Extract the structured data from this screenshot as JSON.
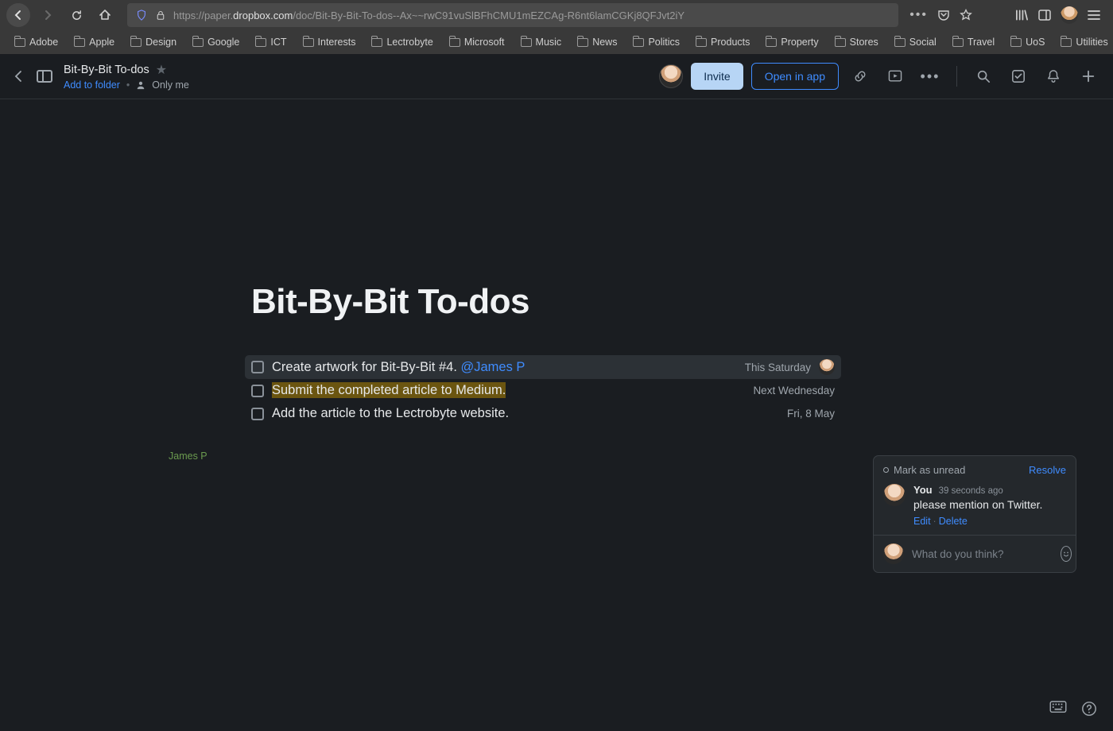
{
  "browser": {
    "url_prefix": "https://paper.",
    "url_host": "dropbox.com",
    "url_path": "/doc/Bit-By-Bit-To-dos--Ax~~rwC91vuSlBFhCMU1mEZCAg-R6nt6lamCGKj8QFJvt2iY",
    "bookmarks": [
      "Adobe",
      "Apple",
      "Design",
      "Google",
      "ICT",
      "Interests",
      "Lectrobyte",
      "Microsoft",
      "Music",
      "News",
      "Politics",
      "Products",
      "Property",
      "Stores",
      "Social",
      "Travel",
      "UoS",
      "Utilities"
    ]
  },
  "header": {
    "doc_title": "Bit-By-Bit To-dos",
    "add_to_folder": "Add to folder",
    "visibility": "Only me",
    "invite": "Invite",
    "open_in_app": "Open in app"
  },
  "document": {
    "title": "Bit-By-Bit To-dos",
    "author_label": "James P",
    "todos": [
      {
        "text": "Create artwork for Bit-By-Bit #4. ",
        "mention": "@James P",
        "due": "This Saturday",
        "has_avatar": true,
        "selected": true
      },
      {
        "text": "Submit the completed article to Medium.",
        "due": "Next Wednesday",
        "highlighted": true
      },
      {
        "text": "Add the article to the Lectrobyte website.",
        "due": "Fri, 8 May"
      }
    ]
  },
  "comment": {
    "mark_unread": "Mark as unread",
    "resolve": "Resolve",
    "author": "You",
    "time": "39 seconds ago",
    "body": "please mention on Twitter.",
    "edit": "Edit",
    "delete": "Delete",
    "placeholder": "What do you think?"
  }
}
